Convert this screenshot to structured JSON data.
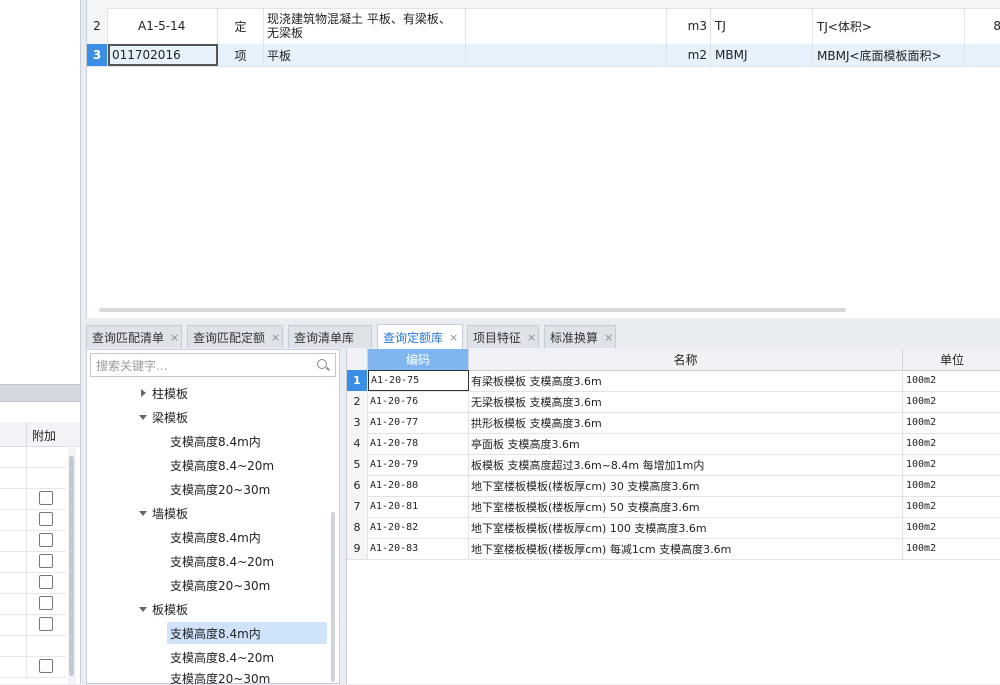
{
  "top_grid": {
    "rows": [
      {
        "index": "2",
        "code": "A1-5-14",
        "type": "定",
        "name": "现浇建筑物混凝土 平板、有梁板、无梁板",
        "unit": "m3",
        "expr": "TJ",
        "expr_desc": "TJ<体积>",
        "extra": "8"
      },
      {
        "index": "3",
        "code": "011702016",
        "type": "项",
        "name": "平板",
        "unit": "m2",
        "expr": "MBMJ",
        "expr_desc": "MBMJ<底面模板面积>",
        "extra": ""
      }
    ]
  },
  "tabs": [
    {
      "label": "查询匹配清单"
    },
    {
      "label": "查询匹配定额"
    },
    {
      "label": "查询清单库"
    },
    {
      "label": "查询定额库",
      "active": true
    },
    {
      "label": "项目特征"
    },
    {
      "label": "标准换算"
    }
  ],
  "tab_close_glyph": "×",
  "search": {
    "placeholder": "搜索关键字..."
  },
  "tree": [
    {
      "label": "柱模板",
      "level": 1,
      "state": "collapsed"
    },
    {
      "label": "梁模板",
      "level": 1,
      "state": "expanded"
    },
    {
      "label": "支模高度8.4m内",
      "level": 2
    },
    {
      "label": "支模高度8.4~20m",
      "level": 2
    },
    {
      "label": "支模高度20~30m",
      "level": 2
    },
    {
      "label": "墙模板",
      "level": 1,
      "state": "expanded"
    },
    {
      "label": "支模高度8.4m内",
      "level": 2
    },
    {
      "label": "支模高度8.4~20m",
      "level": 2
    },
    {
      "label": "支模高度20~30m",
      "level": 2
    },
    {
      "label": "板模板",
      "level": 1,
      "state": "expanded"
    },
    {
      "label": "支模高度8.4m内",
      "level": 2,
      "selected": true
    },
    {
      "label": "支模高度8.4~20m",
      "level": 2
    },
    {
      "label": "支模高度20~30m",
      "level": 2
    }
  ],
  "quota_table": {
    "headers": {
      "code": "编码",
      "name": "名称",
      "unit": "单位"
    },
    "rows": [
      {
        "index": "1",
        "code": "A1-20-75",
        "name": "有梁板模板 支模高度3.6m",
        "unit": "100m2"
      },
      {
        "index": "2",
        "code": "A1-20-76",
        "name": "无梁板模板 支模高度3.6m",
        "unit": "100m2"
      },
      {
        "index": "3",
        "code": "A1-20-77",
        "name": "拱形板模板 支模高度3.6m",
        "unit": "100m2"
      },
      {
        "index": "4",
        "code": "A1-20-78",
        "name": "亭面板 支模高度3.6m",
        "unit": "100m2"
      },
      {
        "index": "5",
        "code": "A1-20-79",
        "name": "板模板 支模高度超过3.6m~8.4m 每增加1m内",
        "unit": "100m2"
      },
      {
        "index": "6",
        "code": "A1-20-80",
        "name": "地下室楼板模板(楼板厚cm) 30 支模高度3.6m",
        "unit": "100m2"
      },
      {
        "index": "7",
        "code": "A1-20-81",
        "name": "地下室楼板模板(楼板厚cm) 50 支模高度3.6m",
        "unit": "100m2"
      },
      {
        "index": "8",
        "code": "A1-20-82",
        "name": "地下室楼板模板(楼板厚cm) 100 支模高度3.6m",
        "unit": "100m2"
      },
      {
        "index": "9",
        "code": "A1-20-83",
        "name": "地下室楼板模板(楼板厚cm) 每减1cm 支模高度3.6m",
        "unit": "100m2"
      }
    ]
  },
  "left_panel": {
    "column_label": "附加"
  }
}
